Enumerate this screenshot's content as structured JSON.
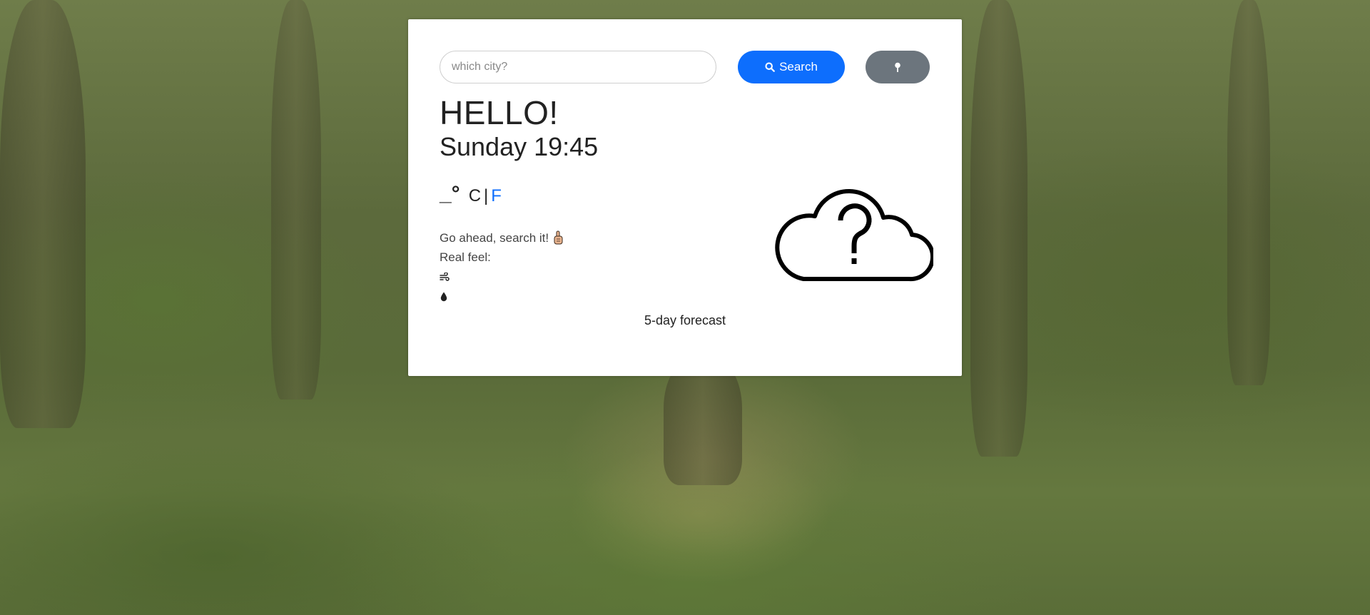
{
  "search": {
    "placeholder": "which city?",
    "value": "",
    "button_label": "Search"
  },
  "greeting": "HELLO!",
  "datetime": "Sunday 19:45",
  "temperature": {
    "value": "_°",
    "unit_c": "C",
    "separator": "|",
    "unit_f": "F",
    "active_unit": "C"
  },
  "description": "Go ahead, search it!",
  "real_feel_label": "Real feel:",
  "forecast_label": "5-day forecast",
  "icons": {
    "search": "search-icon",
    "location": "map-pin-icon",
    "pointing": "pointing-up-hand-icon",
    "wind": "wind-icon",
    "humidity": "droplet-icon",
    "weather": "cloud-question-icon"
  },
  "colors": {
    "primary": "#0d6efd",
    "secondary": "#6c757d",
    "card": "#ffffff"
  }
}
